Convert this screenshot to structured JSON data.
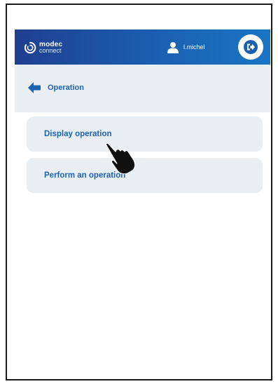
{
  "header": {
    "logo": {
      "brand": "modec",
      "product": "connect",
      "icon": "modec-logo-icon"
    },
    "user": {
      "name": "l.michel",
      "icon": "user-icon"
    },
    "logout_icon": "logout-icon",
    "colors": {
      "gradient_start": "#1f3f8f",
      "gradient_end": "#1a75c4"
    }
  },
  "subheader": {
    "back_icon": "arrow-left-icon",
    "title": "Operation"
  },
  "menu": {
    "items": [
      {
        "label": "Display operation"
      },
      {
        "label": "Perform an operation"
      }
    ]
  },
  "cursor_icon": "hand-pointer-icon",
  "colors": {
    "accent": "#1b63b3",
    "panel": "#e9eef2"
  }
}
